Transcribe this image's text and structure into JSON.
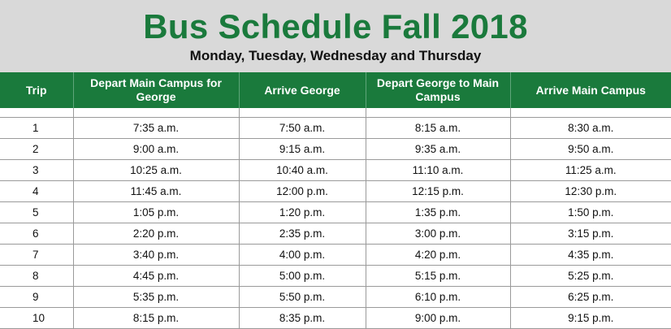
{
  "header": {
    "title": "Bus Schedule Fall 2018",
    "subtitle": "Monday, Tuesday, Wednesday and Thursday"
  },
  "colors": {
    "brand_green": "#1a7a3c",
    "header_bg": "#d9d9d9"
  },
  "table": {
    "columns": [
      "Trip",
      "Depart Main Campus for George",
      "Arrive George",
      "Depart George to Main Campus",
      "Arrive Main Campus"
    ],
    "rows": [
      [
        "1",
        "7:35 a.m.",
        "7:50 a.m.",
        "8:15 a.m.",
        "8:30 a.m."
      ],
      [
        "2",
        "9:00 a.m.",
        "9:15 a.m.",
        "9:35 a.m.",
        "9:50 a.m."
      ],
      [
        "3",
        "10:25 a.m.",
        "10:40 a.m.",
        "11:10 a.m.",
        "11:25 a.m."
      ],
      [
        "4",
        "11:45 a.m.",
        "12:00 p.m.",
        "12:15 p.m.",
        "12:30 p.m."
      ],
      [
        "5",
        "1:05 p.m.",
        "1:20 p.m.",
        "1:35 p.m.",
        "1:50 p.m."
      ],
      [
        "6",
        "2:20 p.m.",
        "2:35 p.m.",
        "3:00 p.m.",
        "3:15 p.m."
      ],
      [
        "7",
        "3:40 p.m.",
        "4:00 p.m.",
        "4:20 p.m.",
        "4:35 p.m."
      ],
      [
        "8",
        "4:45 p.m.",
        "5:00 p.m.",
        "5:15 p.m.",
        "5:25 p.m."
      ],
      [
        "9",
        "5:35 p.m.",
        "5:50 p.m.",
        "6:10 p.m.",
        "6:25 p.m."
      ],
      [
        "10",
        "8:15 p.m.",
        "8:35 p.m.",
        "9:00 p.m.",
        "9:15 p.m."
      ]
    ]
  }
}
